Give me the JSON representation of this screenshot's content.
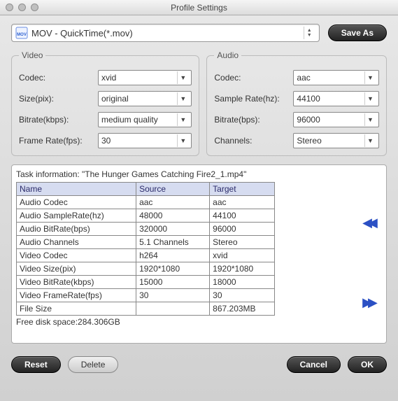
{
  "window": {
    "title": "Profile Settings"
  },
  "profile": {
    "selected": "MOV - QuickTime(*.mov)"
  },
  "buttons": {
    "save_as": "Save As",
    "reset": "Reset",
    "delete": "Delete",
    "cancel": "Cancel",
    "ok": "OK"
  },
  "video": {
    "legend": "Video",
    "codec_label": "Codec:",
    "codec_value": "xvid",
    "size_label": "Size(pix):",
    "size_value": "original",
    "bitrate_label": "Bitrate(kbps):",
    "bitrate_value": "medium quality",
    "fps_label": "Frame Rate(fps):",
    "fps_value": "30"
  },
  "audio": {
    "legend": "Audio",
    "codec_label": "Codec:",
    "codec_value": "aac",
    "sr_label": "Sample Rate(hz):",
    "sr_value": "44100",
    "bitrate_label": "Bitrate(bps):",
    "bitrate_value": "96000",
    "ch_label": "Channels:",
    "ch_value": "Stereo"
  },
  "task": {
    "title": "Task information: \"The Hunger Games Catching Fire2_1.mp4\"",
    "headers": {
      "name": "Name",
      "source": "Source",
      "target": "Target"
    },
    "rows": [
      {
        "name": "Audio Codec",
        "source": "aac",
        "target": "aac"
      },
      {
        "name": "Audio SampleRate(hz)",
        "source": "48000",
        "target": "44100"
      },
      {
        "name": "Audio BitRate(bps)",
        "source": "320000",
        "target": "96000"
      },
      {
        "name": "Audio Channels",
        "source": "5.1 Channels",
        "target": "Stereo"
      },
      {
        "name": "Video Codec",
        "source": "h264",
        "target": "xvid"
      },
      {
        "name": "Video Size(pix)",
        "source": "1920*1080",
        "target": "1920*1080"
      },
      {
        "name": "Video BitRate(kbps)",
        "source": "15000",
        "target": "18000"
      },
      {
        "name": "Video FrameRate(fps)",
        "source": "30",
        "target": "30"
      },
      {
        "name": "File Size",
        "source": "",
        "target": "867.203MB"
      }
    ],
    "free_space": "Free disk space:284.306GB"
  }
}
